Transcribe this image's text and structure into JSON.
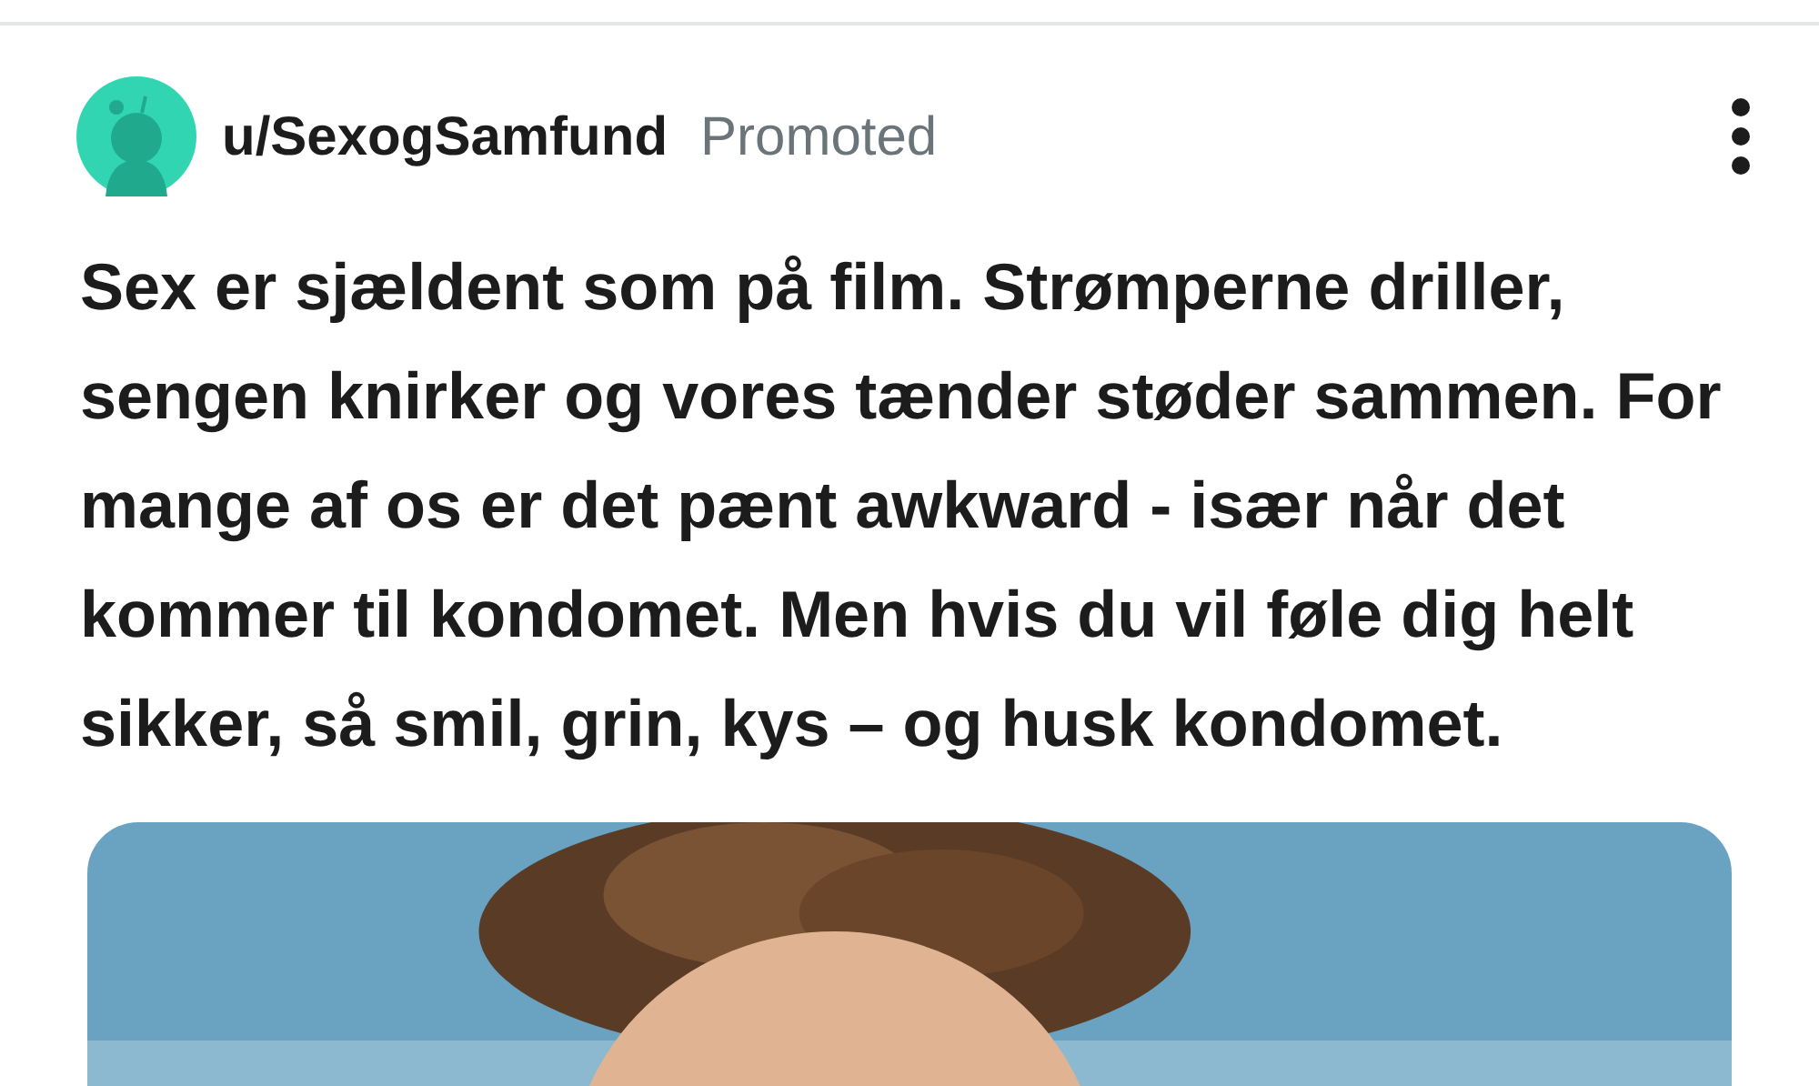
{
  "post": {
    "author": "u/SexogSamfund",
    "label": "Promoted",
    "text": "Sex er sjældent som på film. Strømperne driller, sengen knirker og vores tænder støder sammen. For mange af os er det pænt awkward - især når det kommer til kondomet. Men hvis du vil føle dig helt sikker, så smil, grin, kys – og husk kondomet."
  }
}
